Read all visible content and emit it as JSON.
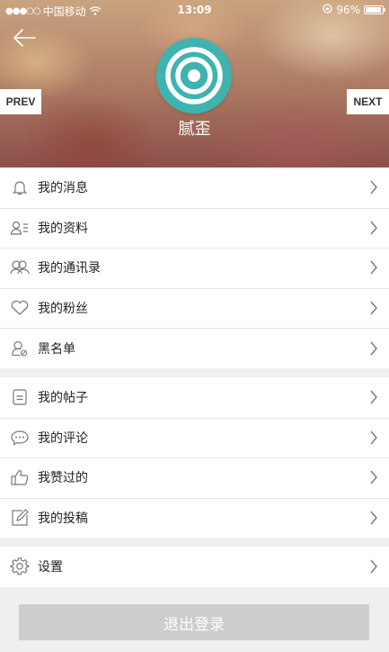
{
  "status_bar": {
    "signal": "●●●○○",
    "carrier": "中国移动",
    "time": "13:09",
    "battery": "96%",
    "battery_level": 0.96
  },
  "profile": {
    "username": "腻歪",
    "prev_label": "PREV",
    "next_label": "NEXT",
    "avatar_color": "#3fb3b0"
  },
  "menu_group_1": [
    {
      "label": "我的消息",
      "icon": "bell-icon"
    },
    {
      "label": "我的资料",
      "icon": "profile-card-icon"
    },
    {
      "label": "我的通讯录",
      "icon": "contacts-icon"
    },
    {
      "label": "我的粉丝",
      "icon": "heart-icon"
    },
    {
      "label": "黑名单",
      "icon": "blocked-user-icon"
    }
  ],
  "menu_group_2": [
    {
      "label": "我的帖子",
      "icon": "document-icon"
    },
    {
      "label": "我的评论",
      "icon": "comment-icon"
    },
    {
      "label": "我赞过的",
      "icon": "thumbs-up-icon"
    },
    {
      "label": "我的投稿",
      "icon": "edit-icon"
    }
  ],
  "menu_group_3": [
    {
      "label": "设置",
      "icon": "gear-icon"
    }
  ],
  "logout_label": "退出登录"
}
